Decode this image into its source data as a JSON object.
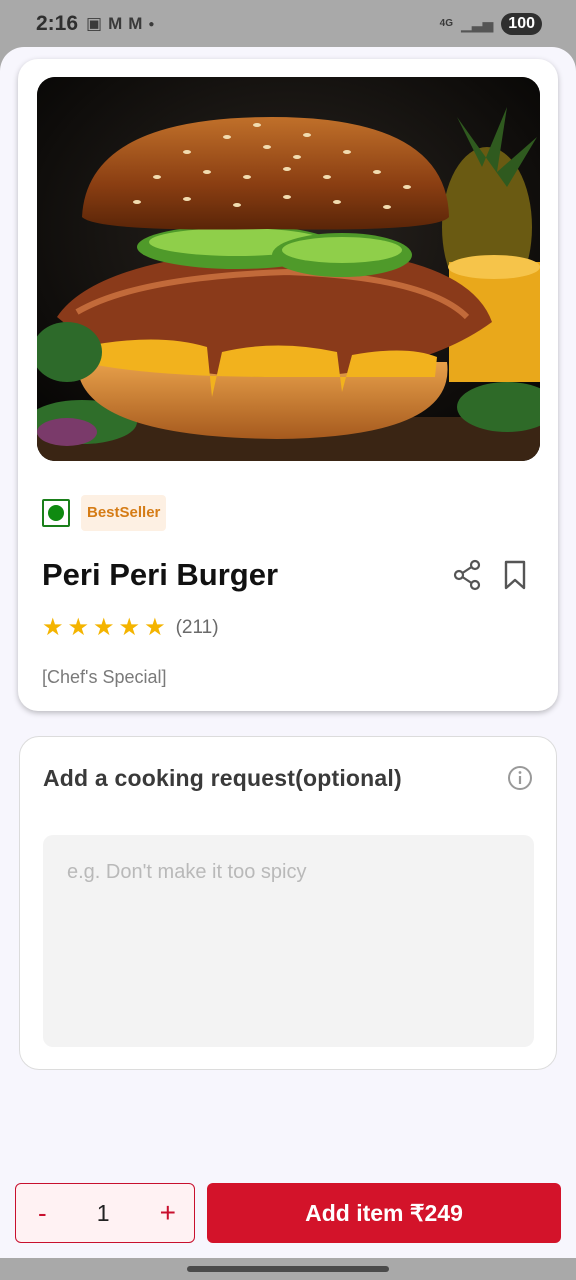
{
  "status_bar": {
    "time": "2:16",
    "notification_icons": [
      "screenshot-icon",
      "gmail-icon",
      "gmail-icon"
    ],
    "network": "4G",
    "battery": "100"
  },
  "item": {
    "image_alt": "burger-photo",
    "veg_indicator": "veg-icon",
    "badge": "BestSeller",
    "name": "Peri Peri Burger",
    "rating_stars": 5,
    "rating_count": "(211)",
    "tag": "[Chef's Special]"
  },
  "cooking_request": {
    "title": "Add a cooking request(optional)",
    "placeholder": "e.g. Don't make it too spicy",
    "value": ""
  },
  "cart": {
    "minus_label": "-",
    "quantity": "1",
    "plus_label": "+",
    "add_label": "Add item ₹249"
  },
  "colors": {
    "accent": "#d3132a",
    "badge_text": "#d57c16",
    "badge_bg": "#fdf0e3",
    "star": "#f4b400",
    "veg": "#0f8a10"
  }
}
